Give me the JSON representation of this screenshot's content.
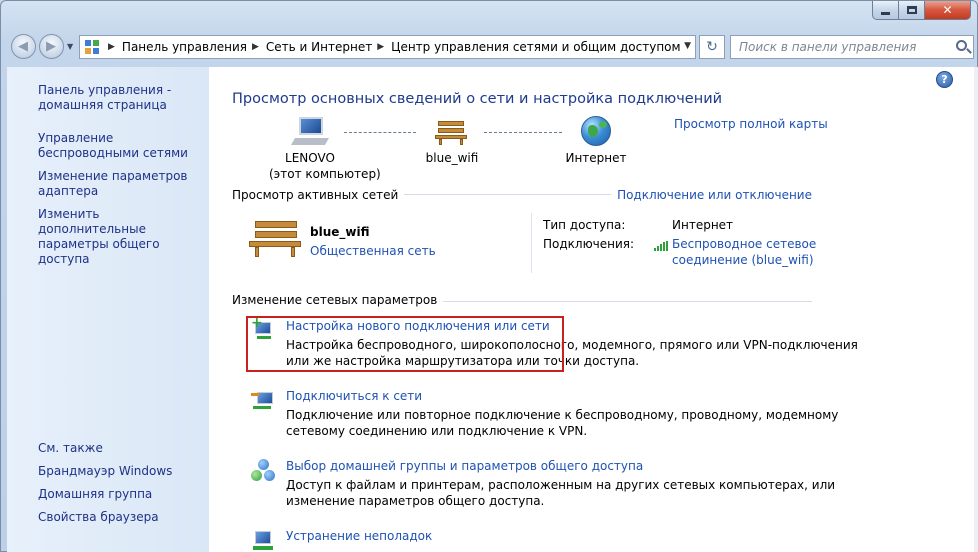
{
  "window": {
    "caption": {
      "minimize": "—",
      "maximize": "",
      "close": "✕"
    }
  },
  "address_bar": {
    "crumbs": [
      "Панель управления",
      "Сеть и Интернет",
      "Центр управления сетями и общим доступом"
    ],
    "search_placeholder": "Поиск в панели управления"
  },
  "sidebar": {
    "items": [
      {
        "label": "Панель управления - домашняя страница"
      },
      {
        "label": "Управление беспроводными сетями"
      },
      {
        "label": "Изменение параметров адаптера"
      },
      {
        "label": "Изменить дополнительные параметры общего доступа"
      }
    ],
    "see_also_title": "См. также",
    "see_also": [
      {
        "label": "Брандмауэр Windows"
      },
      {
        "label": "Домашняя группа"
      },
      {
        "label": "Свойства браузера"
      }
    ]
  },
  "main": {
    "help": "?",
    "title": "Просмотр основных сведений о сети и настройка подключений",
    "full_map_link": "Просмотр полной карты",
    "map": {
      "computer_name": "LENOVO",
      "computer_sub": "(этот компьютер)",
      "network_name": "blue_wifi",
      "internet": "Интернет"
    },
    "active_networks": {
      "heading": "Просмотр активных сетей",
      "connect_link": "Подключение или отключение",
      "network_name": "blue_wifi",
      "network_type": "Общественная сеть",
      "access_type_label": "Тип доступа:",
      "access_type_value": "Интернет",
      "connections_label": "Подключения:",
      "connection_value": "Беспроводное сетевое соединение (blue_wifi)"
    },
    "change_settings": {
      "heading": "Изменение сетевых параметров",
      "tasks": [
        {
          "title": "Настройка нового подключения или сети",
          "desc1": "Настройка беспроводного, широкополосного, модемного, прямого или VPN-подключения",
          "desc2": "или же настройка маршрутизатора или точки доступа."
        },
        {
          "title": "Подключиться к сети",
          "desc1": "Подключение или повторное подключение к беспроводному, проводному, модемному",
          "desc2": "сетевому соединению или подключение к VPN."
        },
        {
          "title": "Выбор домашней группы и параметров общего доступа",
          "desc1": "Доступ к файлам и принтерам, расположенным на других сетевых компьютерах, или",
          "desc2": "изменение параметров общего доступа."
        },
        {
          "title": "Устранение неполадок",
          "desc1": "",
          "desc2": ""
        }
      ]
    }
  },
  "colors": {
    "link": "#1e52b3",
    "title": "#1e3b8e",
    "highlight_border": "#c9211e"
  },
  "icons": [
    "back-arrow-icon",
    "forward-arrow-icon",
    "control-panel-icon",
    "refresh-icon",
    "search-icon",
    "help-icon",
    "computer-icon",
    "bench-network-icon",
    "globe-icon",
    "signal-bars-icon",
    "new-connection-icon",
    "connect-network-icon",
    "homegroup-icon",
    "troubleshoot-icon"
  ]
}
